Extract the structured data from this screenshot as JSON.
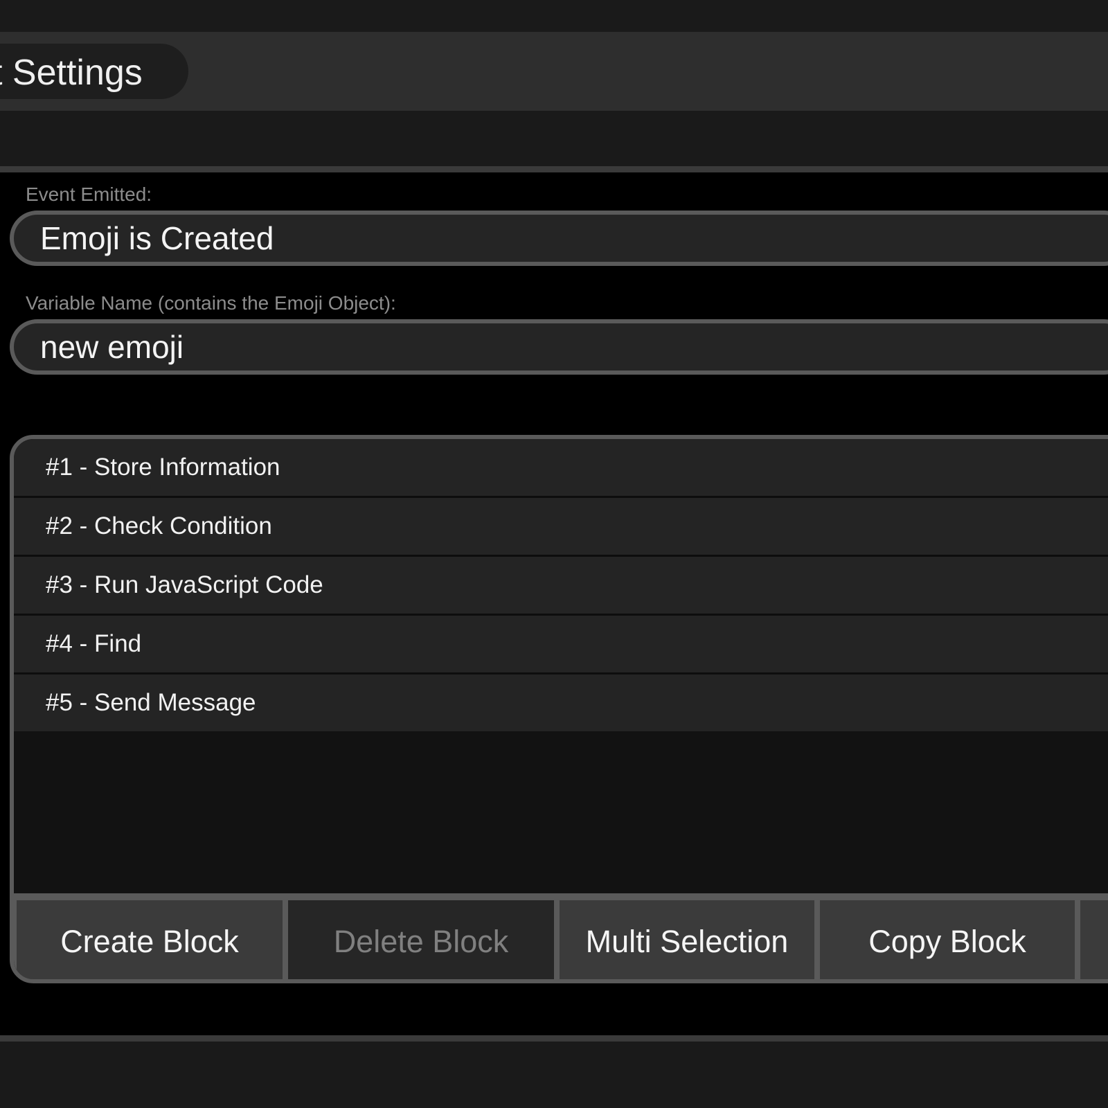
{
  "header": {
    "title": "t Settings"
  },
  "fields": {
    "event_label": "Event Emitted:",
    "event_value": "Emoji is Created",
    "variable_label": "Variable Name (contains the Emoji Object):",
    "variable_value": "new emoji"
  },
  "blocks": [
    {
      "label": "#1 - Store Information"
    },
    {
      "label": "#2 - Check Condition"
    },
    {
      "label": "#3 - Run JavaScript Code"
    },
    {
      "label": "#4 - Find"
    },
    {
      "label": "#5 - Send Message"
    }
  ],
  "buttons": {
    "create": "Create Block",
    "delete": "Delete Block",
    "multi": "Multi Selection",
    "copy": "Copy Block"
  },
  "colors": {
    "background": "#000000",
    "header": "#2e2e2e",
    "field_border": "#5a5a5a",
    "row": "#242424",
    "text": "#f2f2f2",
    "muted_text": "#8c8c8c"
  }
}
